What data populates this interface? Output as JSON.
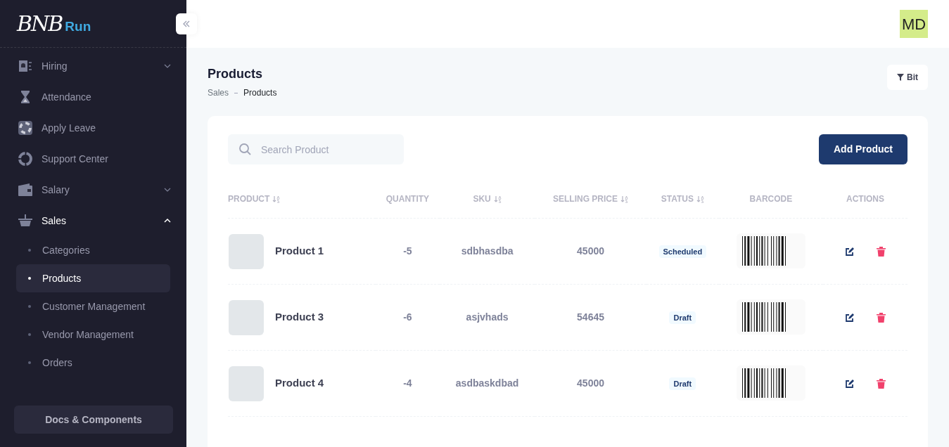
{
  "logo": {
    "mark": "BNB",
    "text": "Run"
  },
  "sidebar": {
    "items": [
      {
        "label": "Hiring",
        "expanded": false
      },
      {
        "label": "Attendance"
      },
      {
        "label": "Apply Leave"
      },
      {
        "label": "Support Center"
      },
      {
        "label": "Salary",
        "expanded": false
      },
      {
        "label": "Sales",
        "expanded": true,
        "children": [
          {
            "label": "Categories",
            "selected": false
          },
          {
            "label": "Products",
            "selected": true
          },
          {
            "label": "Customer Management",
            "selected": false
          },
          {
            "label": "Vendor Management",
            "selected": false
          },
          {
            "label": "Orders",
            "selected": false
          }
        ]
      }
    ],
    "footer_button": "Docs & Components"
  },
  "header": {
    "avatar": "MD"
  },
  "page": {
    "title": "Products",
    "breadcrumb": [
      "Sales",
      "Products"
    ],
    "filter_button": "Bit"
  },
  "search": {
    "placeholder": "Search Product"
  },
  "add_button": "Add Product",
  "table": {
    "columns": [
      {
        "label": "PRODUCT",
        "sortable": true
      },
      {
        "label": "QUANTITY",
        "sortable": false
      },
      {
        "label": "SKU",
        "sortable": true
      },
      {
        "label": "SELLING PRICE",
        "sortable": true
      },
      {
        "label": "STATUS",
        "sortable": true
      },
      {
        "label": "BARCODE",
        "sortable": false
      },
      {
        "label": "ACTIONS",
        "sortable": false
      }
    ],
    "rows": [
      {
        "name": "Product 1",
        "quantity": "-5",
        "sku": "sdbhasdba",
        "price": "45000",
        "status": "Scheduled"
      },
      {
        "name": "Product 3",
        "quantity": "-6",
        "sku": "asjvhads",
        "price": "54645",
        "status": "Draft"
      },
      {
        "name": "Product 4",
        "quantity": "-4",
        "sku": "asdbaskdbad",
        "price": "45000",
        "status": "Draft"
      }
    ]
  }
}
